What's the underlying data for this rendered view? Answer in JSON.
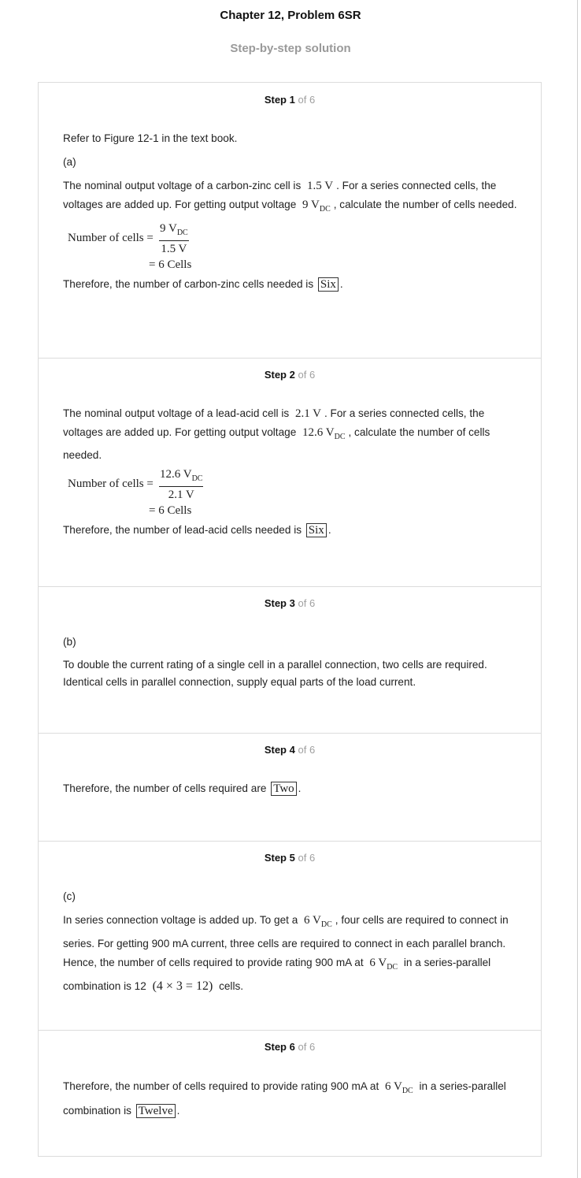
{
  "header": {
    "title": "Chapter 12, Problem 6SR",
    "subtitle": "Step-by-step solution"
  },
  "of_label": "of",
  "steps": [
    {
      "label": "Step 1",
      "total": "6",
      "p1": "Refer to Figure 12-1 in the text book.",
      "part": "(a)",
      "p2a": "The nominal output voltage of a carbon-zinc cell is",
      "p2_v1": "1.5 V",
      "p2b": ". For a series connected cells, the voltages are added up. For getting output voltage",
      "p2_v2": "9 V",
      "p2_v2_sub": "DC",
      "p2c": ", calculate the number of cells needed.",
      "eq_lhs": "Number of cells =",
      "eq_num": "9 V",
      "eq_num_sub": "DC",
      "eq_den": "1.5 V",
      "eq_res": "= 6 Cells",
      "concl": "Therefore, the number of carbon-zinc cells needed is",
      "answer": "Six",
      "end": "."
    },
    {
      "label": "Step 2",
      "total": "6",
      "p2a": "The nominal output voltage of a lead-acid cell is",
      "p2_v1": "2.1 V",
      "p2b": ". For a series connected cells, the voltages are added up. For getting output voltage",
      "p2_v2": "12.6 V",
      "p2_v2_sub": "DC",
      "p2c": ", calculate the number of cells needed.",
      "eq_lhs": "Number of cells =",
      "eq_num": "12.6 V",
      "eq_num_sub": "DC",
      "eq_den": "2.1 V",
      "eq_res": "= 6 Cells",
      "concl": "Therefore, the number of lead-acid cells needed is",
      "answer": "Six",
      "end": "."
    },
    {
      "label": "Step 3",
      "total": "6",
      "part": "(b)",
      "p1": "To double the current rating of a single cell in a parallel connection, two cells are required. Identical cells in parallel connection, supply equal parts of the load current."
    },
    {
      "label": "Step 4",
      "total": "6",
      "concl": "Therefore, the number of cells required are",
      "answer": "Two",
      "end": "."
    },
    {
      "label": "Step 5",
      "total": "6",
      "part": "(c)",
      "p1a": "In series connection voltage is added up. To get a",
      "v1": "6 V",
      "v1_sub": "DC",
      "p1b": ", four cells are required to connect in series. For getting 900 mA current, three cells are required to connect in each parallel branch. Hence, the number of cells required to provide rating 900 mA at",
      "v2": "6 V",
      "v2_sub": "DC",
      "p1c": "in a series-parallel combination is 12",
      "expr": "(4 × 3 = 12)",
      "p1d": "cells."
    },
    {
      "label": "Step 6",
      "total": "6",
      "concl_a": "Therefore, the number of cells required to provide rating 900 mA at",
      "v1": "6 V",
      "v1_sub": "DC",
      "concl_b": "in a series-parallel combination is",
      "answer": "Twelve",
      "end": "."
    }
  ]
}
